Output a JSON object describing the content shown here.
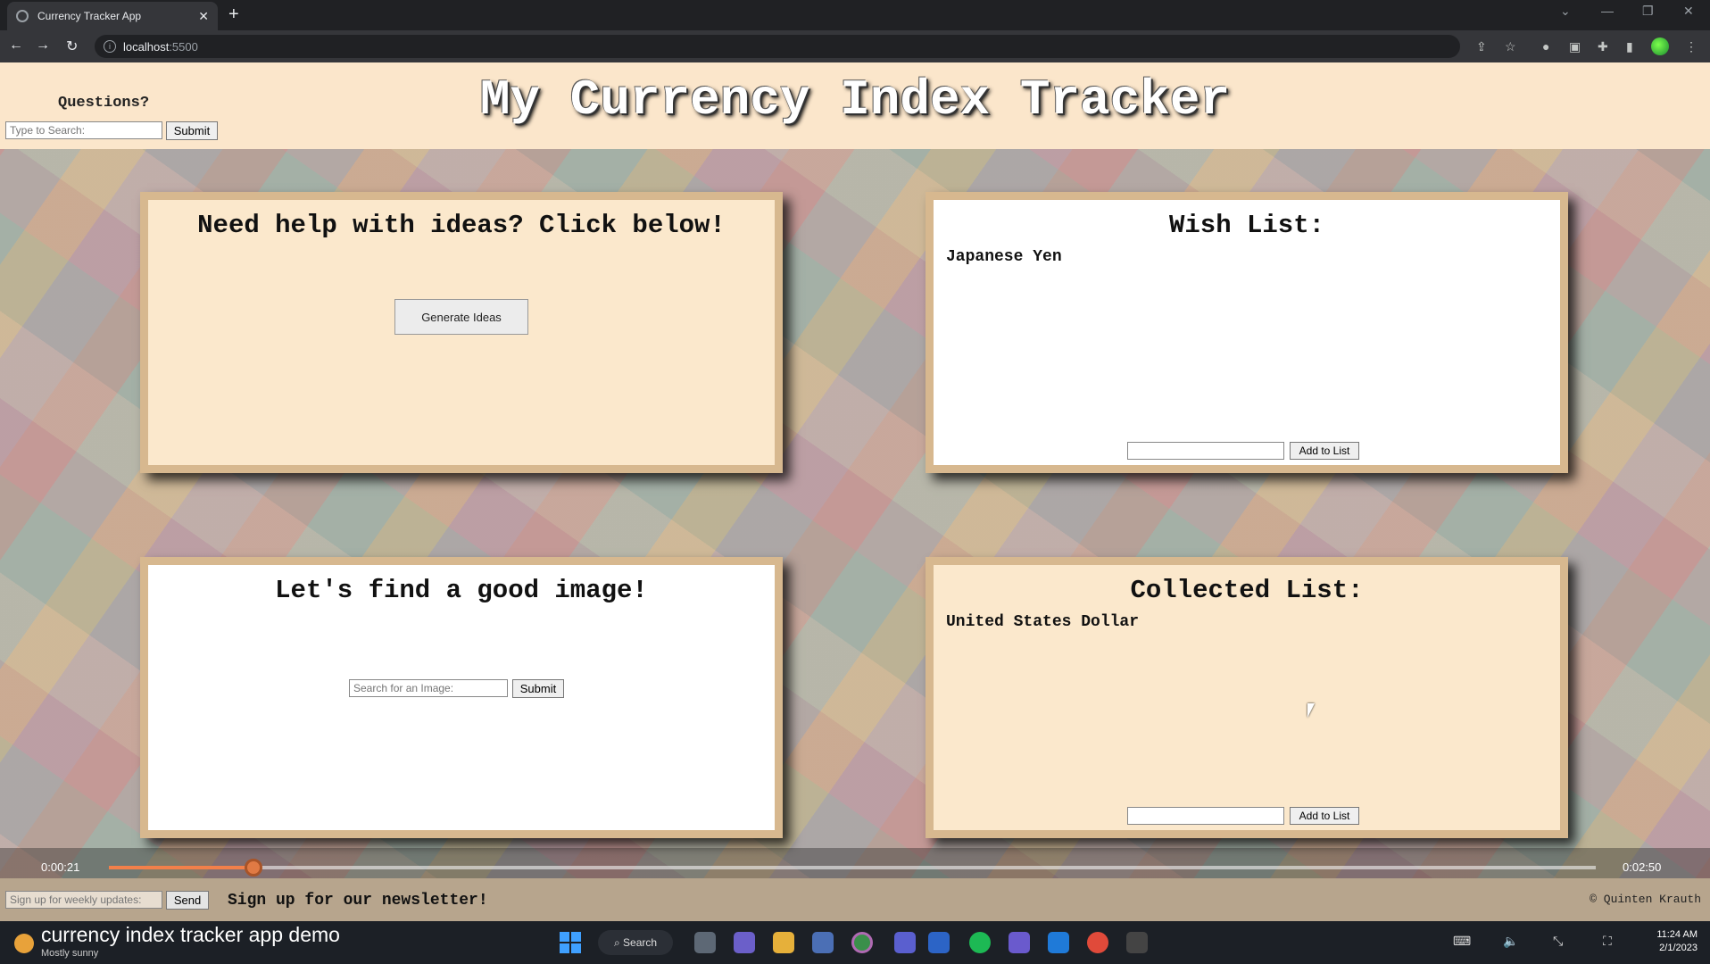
{
  "browser": {
    "tab_title": "Currency Tracker App",
    "url_host": "localhost",
    "url_port": ":5500"
  },
  "header": {
    "title": "My Currency Index Tracker",
    "questions_label": "Questions?",
    "search_placeholder": "Type to Search:",
    "search_submit": "Submit"
  },
  "ideas_panel": {
    "heading": "Need help with ideas? Click below!",
    "button_label": "Generate Ideas"
  },
  "wish_panel": {
    "heading": "Wish List:",
    "items": [
      "Japanese Yen"
    ],
    "add_button": "Add to List"
  },
  "image_panel": {
    "heading": "Let's find a good image!",
    "search_placeholder": "Search for an Image:",
    "submit": "Submit"
  },
  "collected_panel": {
    "heading": "Collected List:",
    "items": [
      "United States Dollar"
    ],
    "add_button": "Add to List"
  },
  "player": {
    "current_time": "0:00:21",
    "total_time": "0:02:50",
    "progress": 0.097
  },
  "footer": {
    "newsletter_placeholder": "Sign up for weekly updates:",
    "send_label": "Send",
    "newsletter_text": "Sign up for our newsletter!",
    "credit": "© Quinten Krauth"
  },
  "taskbar": {
    "overlay_title": "currency index tracker app demo",
    "weather": "Mostly sunny",
    "search_label": "Search",
    "time": "11:24 AM",
    "date": "2/1/2023"
  },
  "colors": {
    "header_bg": "#fbe6cb",
    "panel_border": "#d7b88f",
    "panel_cream": "#fbe8cc",
    "progress": "#f2804a"
  }
}
